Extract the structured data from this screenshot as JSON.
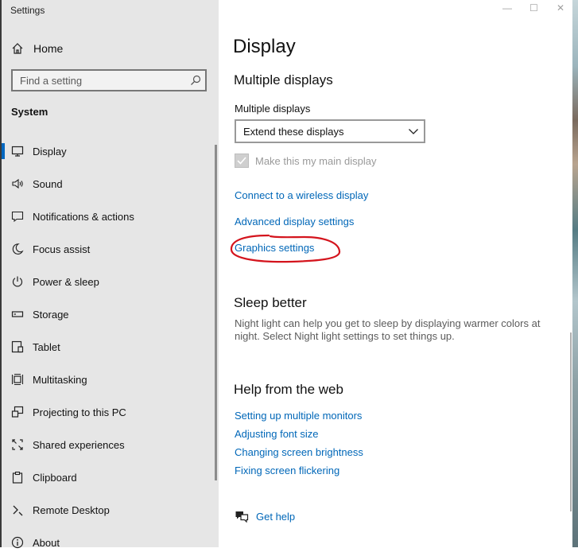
{
  "app": {
    "title": "Settings"
  },
  "sidebar": {
    "home_label": "Home",
    "search_placeholder": "Find a setting",
    "section_label": "System",
    "items": [
      {
        "label": "Display",
        "icon": "monitor-icon",
        "selected": true
      },
      {
        "label": "Sound",
        "icon": "speaker-icon"
      },
      {
        "label": "Notifications & actions",
        "icon": "notification-icon"
      },
      {
        "label": "Focus assist",
        "icon": "moon-icon"
      },
      {
        "label": "Power & sleep",
        "icon": "power-icon"
      },
      {
        "label": "Storage",
        "icon": "storage-icon"
      },
      {
        "label": "Tablet",
        "icon": "tablet-icon"
      },
      {
        "label": "Multitasking",
        "icon": "multitasking-icon"
      },
      {
        "label": "Projecting to this PC",
        "icon": "projecting-icon"
      },
      {
        "label": "Shared experiences",
        "icon": "shared-experiences-icon"
      },
      {
        "label": "Clipboard",
        "icon": "clipboard-icon"
      },
      {
        "label": "Remote Desktop",
        "icon": "remote-desktop-icon"
      },
      {
        "label": "About",
        "icon": "info-icon"
      }
    ]
  },
  "main": {
    "page_title": "Display",
    "multiple_displays": {
      "heading": "Multiple displays",
      "field_label": "Multiple displays",
      "selected_value": "Extend these displays",
      "checkbox_label": "Make this my main display",
      "checkbox_checked": true,
      "checkbox_disabled": true
    },
    "links": [
      "Connect to a wireless display",
      "Advanced display settings",
      "Graphics settings"
    ],
    "sleep": {
      "heading": "Sleep better",
      "text": "Night light can help you get to sleep by displaying warmer colors at night. Select Night light settings to set things up."
    },
    "help": {
      "heading": "Help from the web",
      "links": [
        "Setting up multiple monitors",
        "Adjusting font size",
        "Changing screen brightness",
        "Fixing screen flickering"
      ],
      "get_help": "Get help"
    }
  },
  "window_controls": {
    "minimize": "—",
    "maximize": "☐",
    "close": "✕"
  },
  "colors": {
    "accent": "#0067c0",
    "link": "#0067b8",
    "annotation": "#d4141d",
    "sidebar_bg": "#e6e6e6"
  }
}
